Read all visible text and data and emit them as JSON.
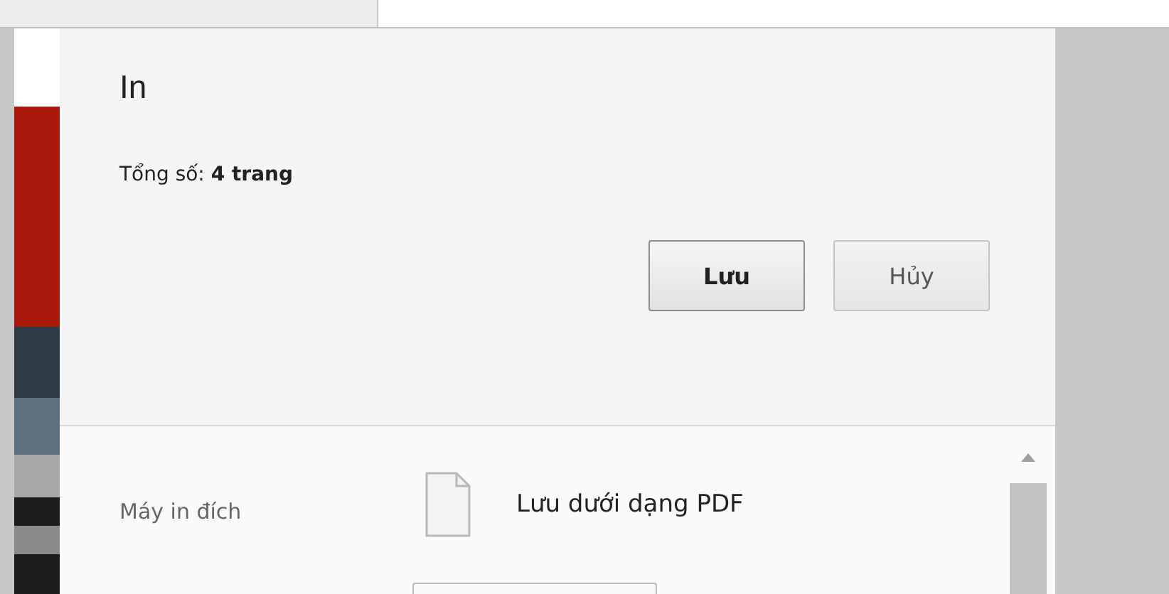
{
  "dialog": {
    "title": "In",
    "summary": "Tổng số: **4 trang**",
    "buttons": [
      {
        "label": "Lưu",
        "kind": "primary"
      },
      {
        "label": "Hủy",
        "kind": "secondary"
      }
    ]
  },
  "destination": {
    "label": "Máy in đích",
    "printer": "Lưu dưới dạng PDF"
  }
}
